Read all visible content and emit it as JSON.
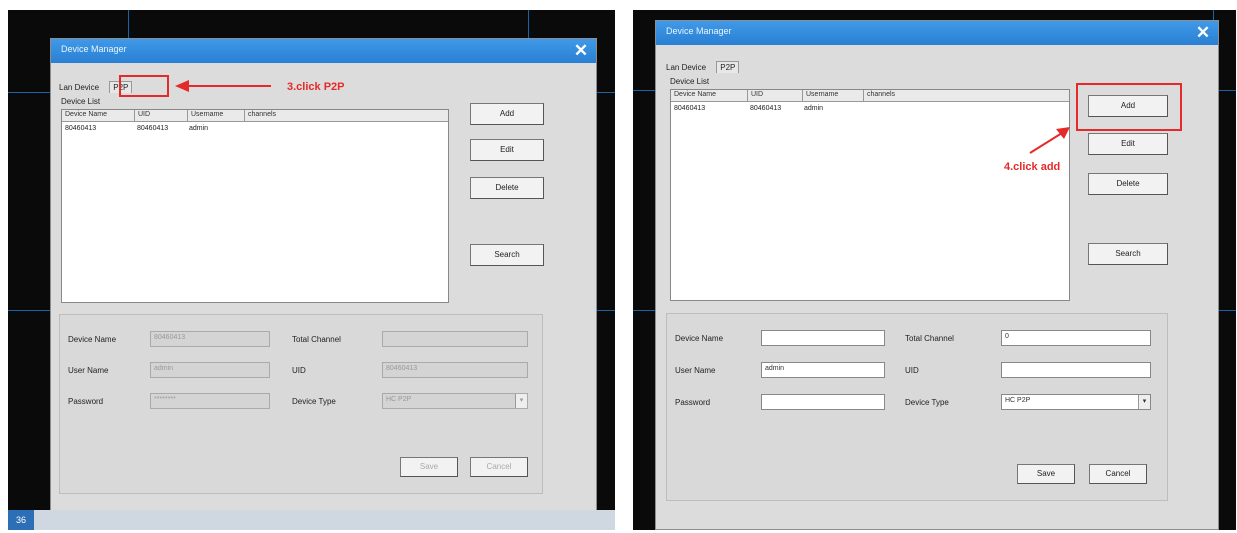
{
  "colors": {
    "accent": "#2a7fd3",
    "annotation": "#e52a2a",
    "background": "#0a0a0a"
  },
  "left": {
    "title": "Device Manager",
    "tabs": [
      "Lan Device",
      "P2P"
    ],
    "device_list_label": "Device List",
    "columns": [
      "Device Name",
      "UID",
      "Username",
      "channels"
    ],
    "rows": [
      {
        "device_name": "80460413",
        "uid": "80460413",
        "username": "admin",
        "channels": ""
      }
    ],
    "buttons": {
      "add": "Add",
      "edit": "Edit",
      "delete": "Delete",
      "search": "Search",
      "save": "Save",
      "cancel": "Cancel"
    },
    "fields": {
      "device_name_label": "Device Name",
      "device_name_value": "80460413",
      "user_name_label": "User Name",
      "user_name_value": "admin",
      "password_label": "Password",
      "password_value": "********",
      "total_channel_label": "Total Channel",
      "total_channel_value": "",
      "uid_label": "UID",
      "uid_value": "80460413",
      "device_type_label": "Device Type",
      "device_type_value": "HC P2P"
    },
    "annotation": "3.click P2P",
    "taskbar_icon": "36"
  },
  "right": {
    "title": "Device Manager",
    "tabs": [
      "Lan Device",
      "P2P"
    ],
    "device_list_label": "Device List",
    "columns": [
      "Device Name",
      "UID",
      "Username",
      "channels"
    ],
    "rows": [
      {
        "device_name": "80460413",
        "uid": "80460413",
        "username": "admin",
        "channels": ""
      }
    ],
    "buttons": {
      "add": "Add",
      "edit": "Edit",
      "delete": "Delete",
      "search": "Search",
      "save": "Save",
      "cancel": "Cancel"
    },
    "fields": {
      "device_name_label": "Device Name",
      "device_name_value": "",
      "user_name_label": "User Name",
      "user_name_value": "admin",
      "password_label": "Password",
      "password_value": "",
      "total_channel_label": "Total Channel",
      "total_channel_value": "0",
      "uid_label": "UID",
      "uid_value": "",
      "device_type_label": "Device Type",
      "device_type_value": "HC P2P"
    },
    "annotation": "4.click add"
  }
}
